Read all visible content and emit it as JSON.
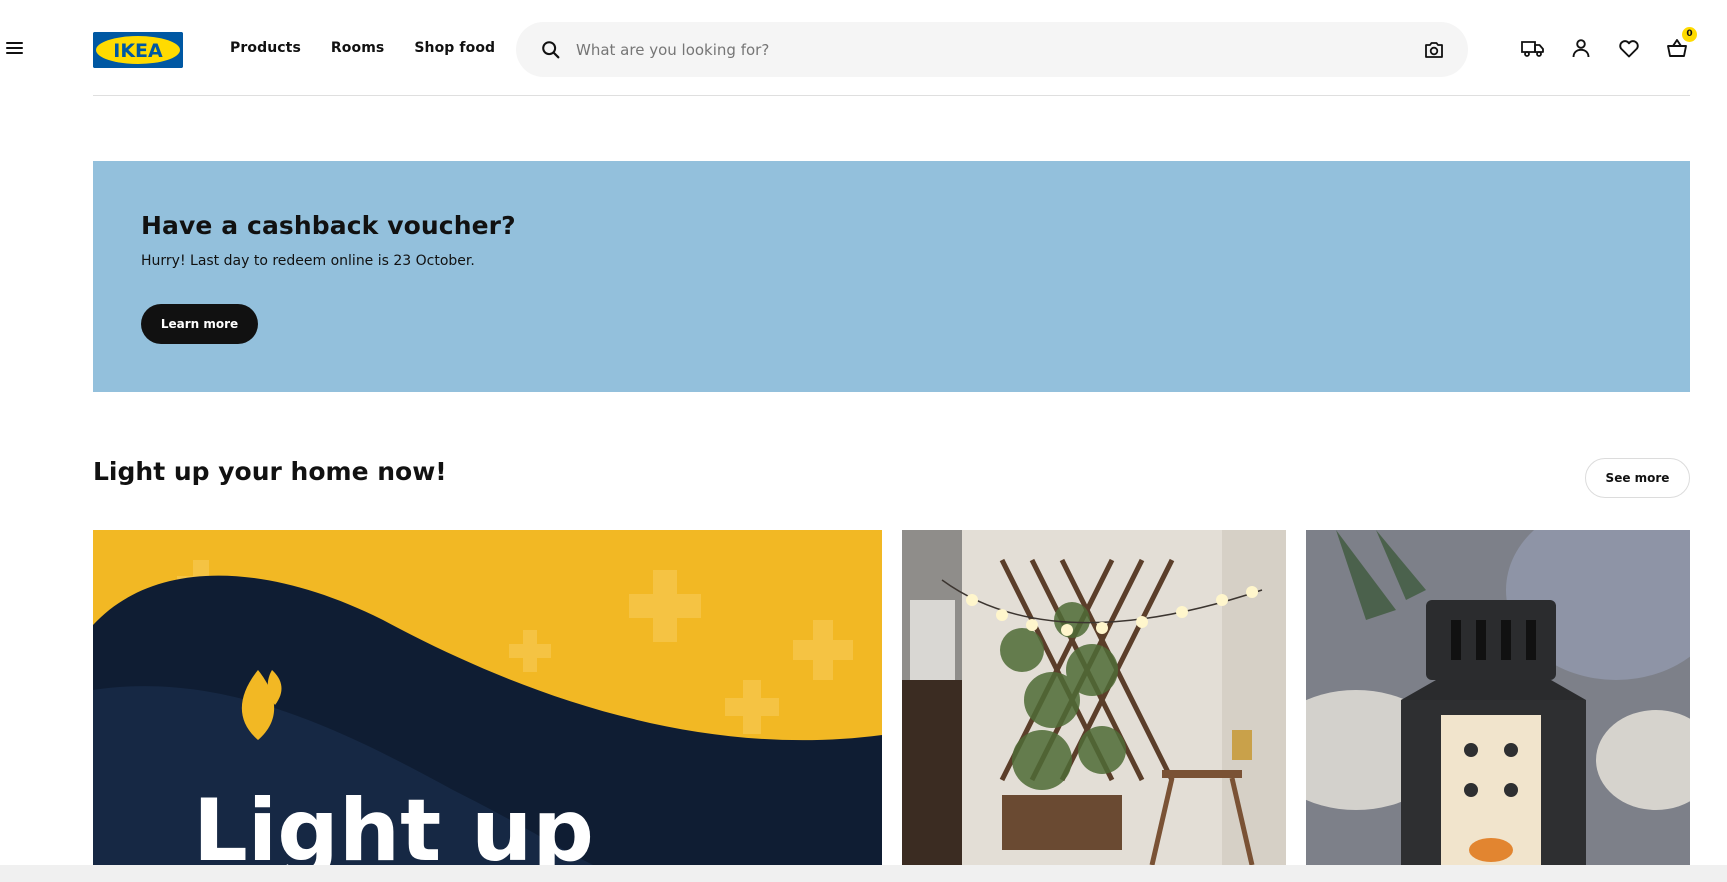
{
  "header": {
    "logo_text": "IKEA",
    "nav": [
      "Products",
      "Rooms",
      "Shop food"
    ],
    "search_placeholder": "What are you looking for?",
    "cart_count": "0",
    "icons": [
      "menu-icon",
      "search-icon",
      "camera-icon",
      "delivery-truck-icon",
      "account-icon",
      "heart-icon",
      "cart-icon"
    ]
  },
  "banner": {
    "title": "Have a cashback voucher?",
    "text": "Hurry! Last day to redeem online is 23 October.",
    "button": "Learn more",
    "bg_color": "#93c0dc"
  },
  "section": {
    "title": "Light up your home now!",
    "see_more": "See more",
    "card1_text": "Light up"
  },
  "colors": {
    "ikea_blue": "#0058a3",
    "ikea_yellow": "#ffdb00",
    "promo_yellow": "#f2b824",
    "promo_navy": "#0f1d33"
  }
}
